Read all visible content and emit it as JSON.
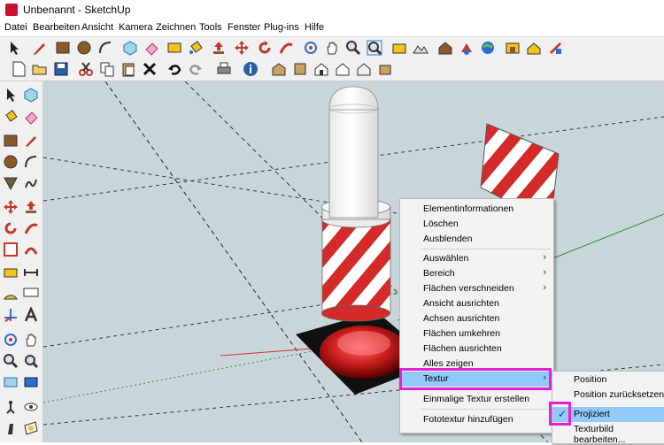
{
  "window": {
    "title": "Unbenannt - SketchUp"
  },
  "menubar": {
    "items": [
      {
        "label": "Datei"
      },
      {
        "label": "Bearbeiten"
      },
      {
        "label": "Ansicht"
      },
      {
        "label": "Kamera"
      },
      {
        "label": "Zeichnen"
      },
      {
        "label": "Tools"
      },
      {
        "label": "Fenster"
      },
      {
        "label": "Plug-ins"
      },
      {
        "label": "Hilfe"
      }
    ]
  },
  "context_menu": {
    "items": [
      {
        "label": "Elementinformationen",
        "submenu": false
      },
      {
        "label": "Löschen",
        "submenu": false
      },
      {
        "label": "Ausblenden",
        "submenu": false
      },
      {
        "label": "Auswählen",
        "submenu": true
      },
      {
        "label": "Bereich",
        "submenu": true
      },
      {
        "label": "Flächen verschneiden",
        "submenu": true
      },
      {
        "label": "Ansicht ausrichten",
        "submenu": false
      },
      {
        "label": "Achsen ausrichten",
        "submenu": false
      },
      {
        "label": "Flächen umkehren",
        "submenu": false
      },
      {
        "label": "Flächen ausrichten",
        "submenu": false
      },
      {
        "label": "Alles zeigen",
        "submenu": false
      },
      {
        "label": "Textur",
        "submenu": true,
        "highlighted": true
      },
      {
        "label": "Einmalige Textur erstellen",
        "submenu": false
      },
      {
        "label": "Fototextur hinzufügen",
        "submenu": false
      }
    ],
    "arrow_glyph": "›"
  },
  "texture_submenu": {
    "items": [
      {
        "label": "Position",
        "checked": false
      },
      {
        "label": "Position zurücksetzen",
        "checked": false
      },
      {
        "label": "Projiziert",
        "checked": true,
        "highlighted": true
      },
      {
        "label": "Texturbild bearbeiten...",
        "checked": false
      }
    ],
    "check_glyph": "✓"
  },
  "colors": {
    "highlight": "#91c9f7",
    "annotation": "#e61fd6",
    "viewport_bg": "#c9d6d9",
    "stripe_red": "#d42a2a"
  }
}
